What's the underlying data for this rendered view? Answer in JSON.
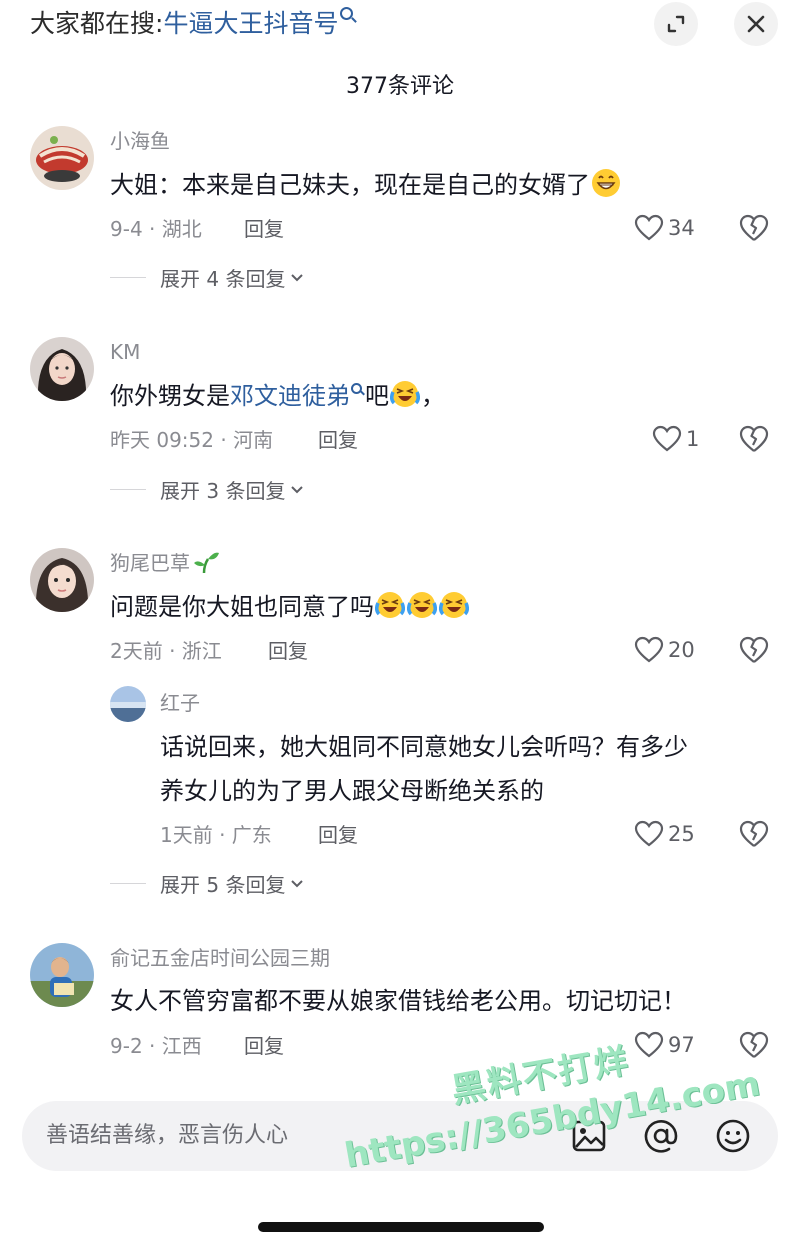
{
  "header": {
    "search_prefix": "大家都在搜:",
    "search_keyword": "牛逼大王抖音号",
    "comment_count": "377条评论"
  },
  "comments": [
    {
      "username": "小海鱼",
      "text": "大姐：本来是自己妹夫，现在是自己的女婿了",
      "meta": "9-4 · 湖北",
      "reply_label": "回复",
      "likes": "34",
      "expand": "展开 4 条回复"
    },
    {
      "username": "KM",
      "text_before": "你外甥女是",
      "text_link": "邓文迪徒弟",
      "text_after": "吧",
      "text_end": "，",
      "meta": "昨天 09:52 · 河南",
      "reply_label": "回复",
      "likes": "1",
      "expand": "展开 3 条回复"
    },
    {
      "username": "狗尾巴草",
      "text": "问题是你大姐也同意了吗",
      "meta": "2天前 · 浙江",
      "reply_label": "回复",
      "likes": "20",
      "reply": {
        "username": "红子",
        "text_line1": "话说回来，她大姐同不同意她女儿会听吗？有多少",
        "text_line2": "养女儿的为了男人跟父母断绝关系的",
        "meta": "1天前 · 广东",
        "reply_label": "回复",
        "likes": "25"
      },
      "expand": "展开 5 条回复"
    },
    {
      "username": "俞记五金店时间公园三期",
      "text": "女人不管穷富都不要从娘家借钱给老公用。切记切记！",
      "meta": "9-2 · 江西",
      "reply_label": "回复",
      "likes": "97"
    }
  ],
  "input": {
    "placeholder": "善语结善缘，恶言伤人心"
  },
  "watermark": {
    "line1": "黑料不打烊",
    "line2": "https://365bdy14.com"
  },
  "colors": {
    "link": "#2f5f9e",
    "muted": "#8a8b91",
    "text": "#161823"
  }
}
